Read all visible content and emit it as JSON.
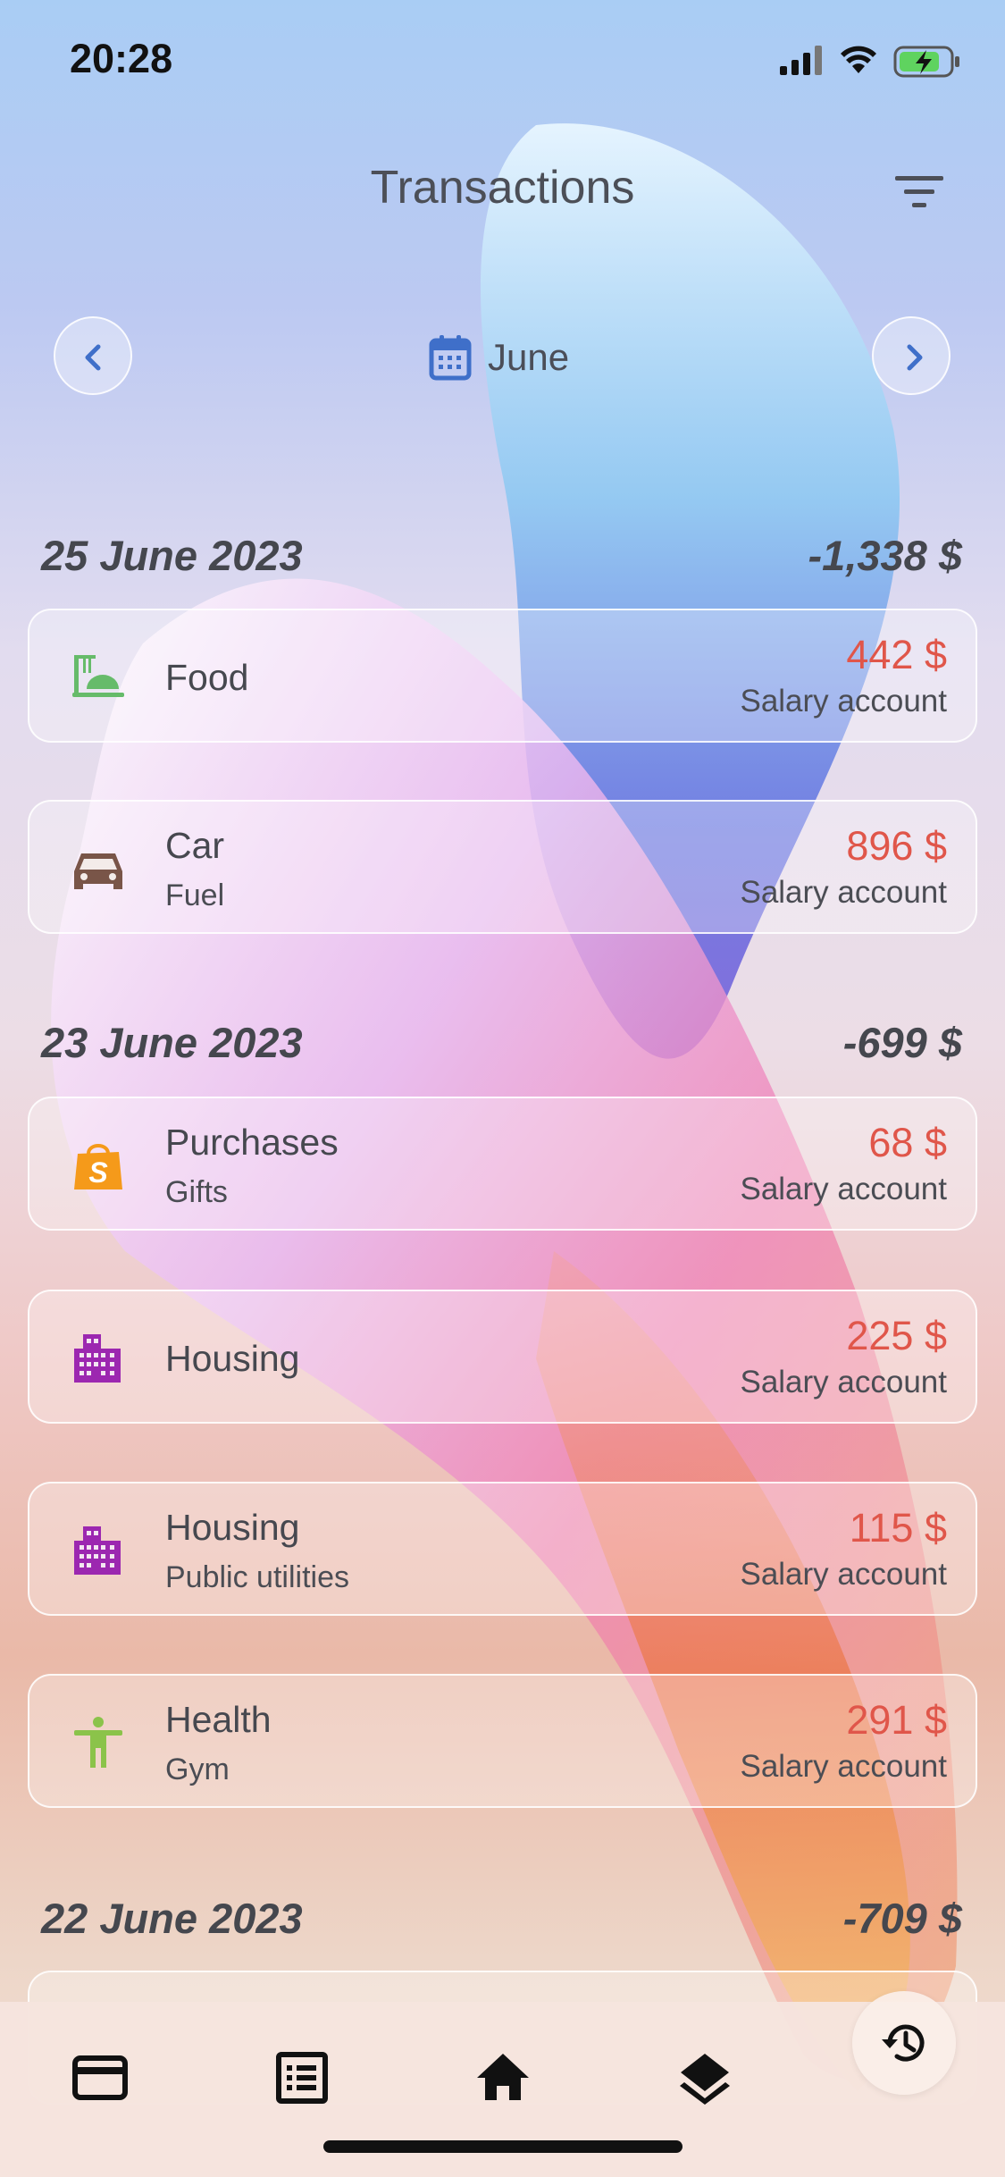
{
  "status_bar": {
    "time": "20:28"
  },
  "header": {
    "title": "Transactions"
  },
  "month_nav": {
    "month": "June"
  },
  "groups": [
    {
      "date": "25 June 2023",
      "total": "-1,338 $"
    },
    {
      "date": "23 June 2023",
      "total": "-699 $"
    },
    {
      "date": "22 June 2023",
      "total": "-709 $"
    }
  ],
  "transactions": [
    {
      "category": "Food",
      "subcategory": "",
      "amount": "442 $",
      "account": "Salary account",
      "icon": "food-icon",
      "icon_color": "#66bb6a"
    },
    {
      "category": "Car",
      "subcategory": "Fuel",
      "amount": "896 $",
      "account": "Salary account",
      "icon": "car-icon",
      "icon_color": "#795548"
    },
    {
      "category": "Purchases",
      "subcategory": "Gifts",
      "amount": "68 $",
      "account": "Salary account",
      "icon": "shopping-bag-icon",
      "icon_color": "#f59a1a"
    },
    {
      "category": "Housing",
      "subcategory": "",
      "amount": "225 $",
      "account": "Salary account",
      "icon": "building-icon",
      "icon_color": "#9c27b0"
    },
    {
      "category": "Housing",
      "subcategory": "Public utilities",
      "amount": "115 $",
      "account": "Salary account",
      "icon": "building-icon",
      "icon_color": "#9c27b0"
    },
    {
      "category": "Health",
      "subcategory": "Gym",
      "amount": "291 $",
      "account": "Salary account",
      "icon": "person-icon",
      "icon_color": "#8bc34a"
    }
  ],
  "colors": {
    "expense": "#e0564a",
    "calendar": "#3f6fc9",
    "text": "#46484f"
  },
  "tab_bar": {
    "icons": [
      "card-icon",
      "list-icon",
      "home-icon",
      "layers-icon"
    ],
    "fab_icon": "history-icon"
  }
}
